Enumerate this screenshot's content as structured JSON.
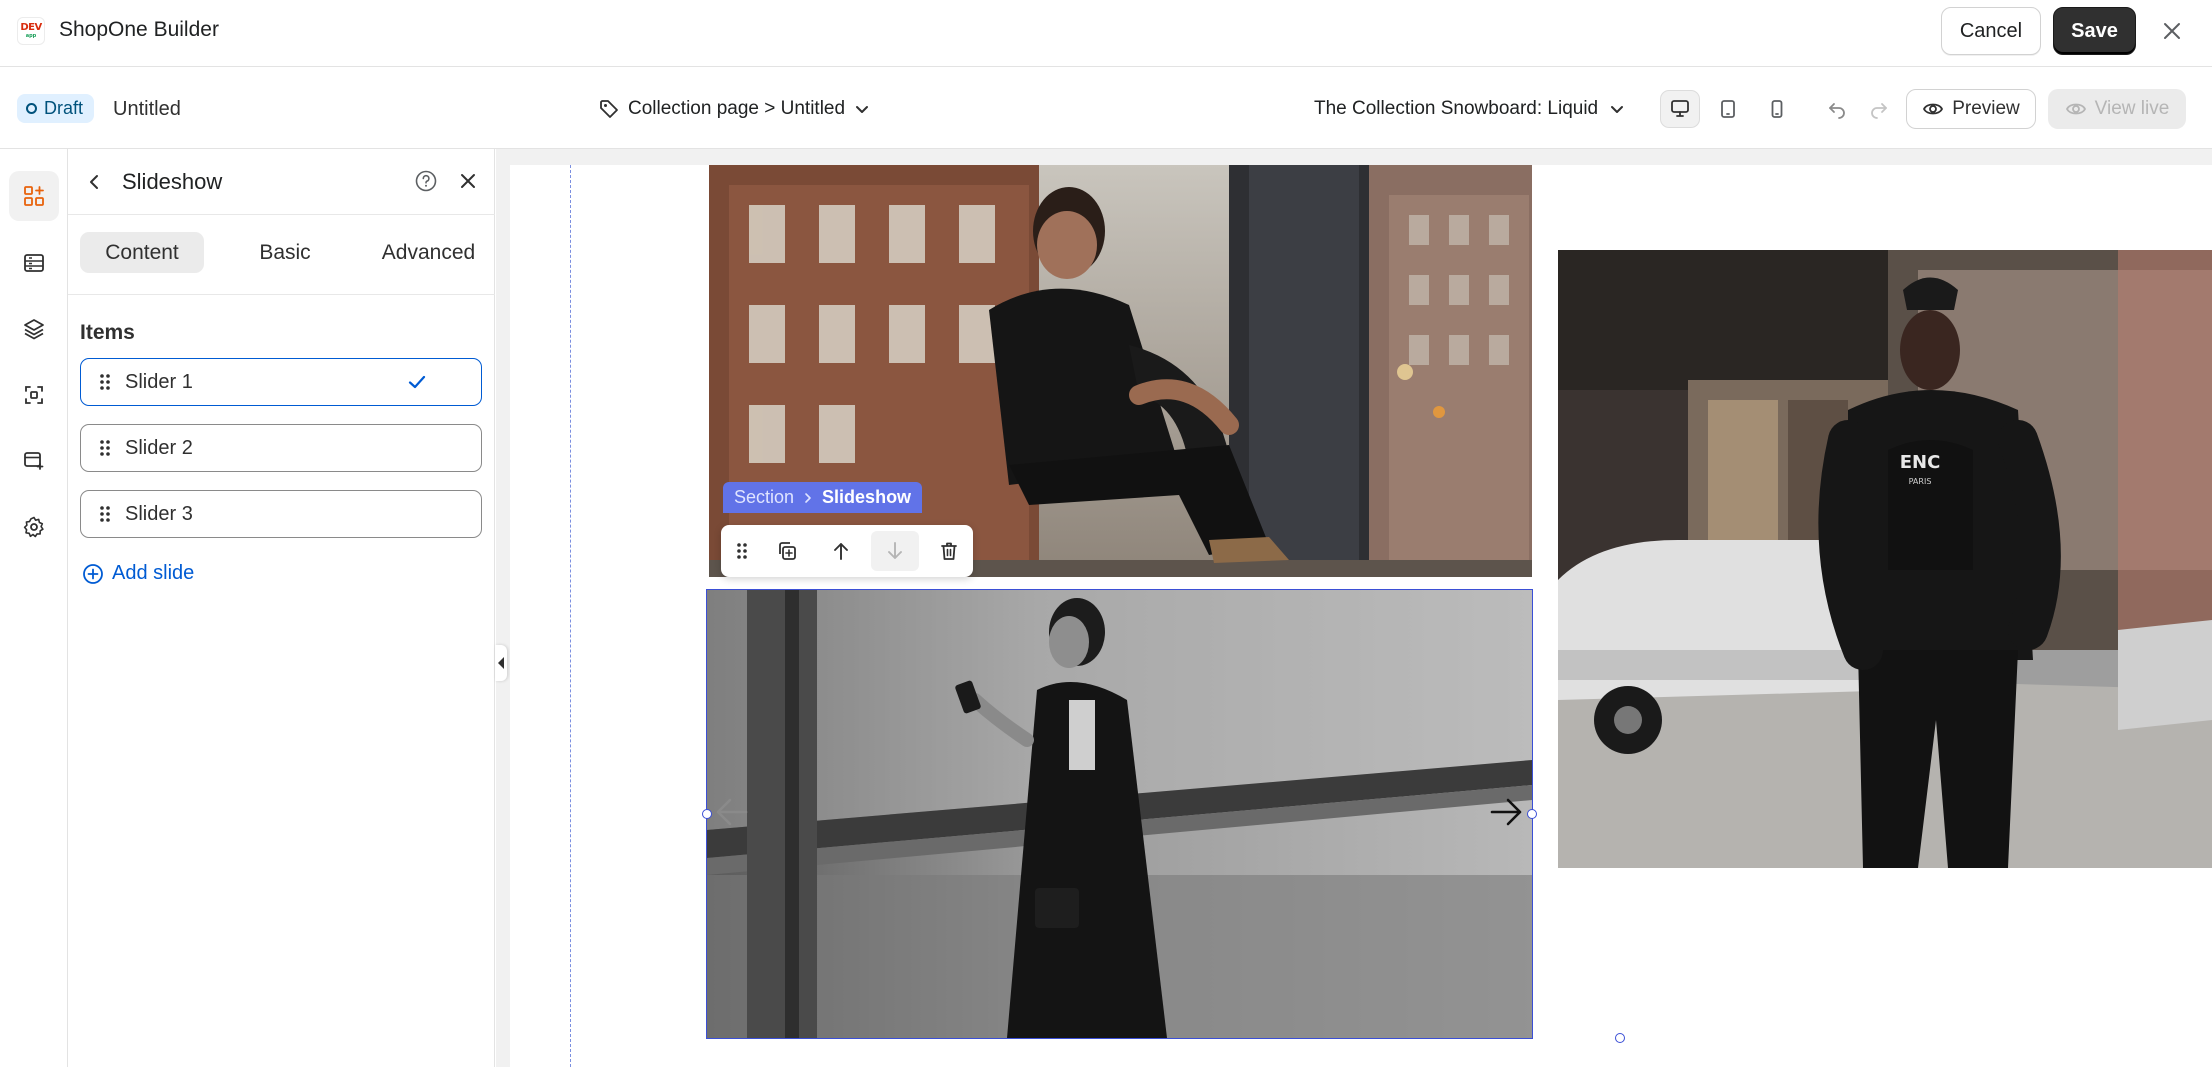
{
  "app": {
    "name": "ShopOne Builder",
    "logo_text": "DEV",
    "logo_subtext": "app"
  },
  "header": {
    "cancel_label": "Cancel",
    "save_label": "Save"
  },
  "subbar": {
    "status_badge": "Draft",
    "page_name": "Untitled",
    "page_selector": "Collection page > Untitled",
    "theme_selector": "The Collection Snowboard: Liquid",
    "preview_label": "Preview",
    "view_live_label": "View live"
  },
  "rail": {
    "items": [
      {
        "icon": "add-section-icon",
        "active": true
      },
      {
        "icon": "sections-icon",
        "active": false
      },
      {
        "icon": "layers-icon",
        "active": false
      },
      {
        "icon": "components-icon",
        "active": false
      },
      {
        "icon": "templates-icon",
        "active": false
      },
      {
        "icon": "settings-gear-icon",
        "active": false
      }
    ]
  },
  "panel": {
    "title": "Slideshow",
    "tabs": [
      {
        "label": "Content",
        "active": true
      },
      {
        "label": "Basic",
        "active": false
      },
      {
        "label": "Advanced",
        "active": false
      }
    ],
    "items_heading": "Items",
    "slides": [
      {
        "label": "Slider 1",
        "selected": true
      },
      {
        "label": "Slider 2",
        "selected": false
      },
      {
        "label": "Slider 3",
        "selected": false
      }
    ],
    "add_slide_label": "Add slide"
  },
  "canvas": {
    "breadcrumb": {
      "parent": "Section",
      "current": "Slideshow"
    },
    "shirt_text": "ENC",
    "shirt_subtext": "PARIS"
  },
  "colors": {
    "accent_blue": "#005bd3",
    "selection_blue": "#3b4fd6",
    "breadcrumb_bg": "#6173e8",
    "save_bg": "#303030",
    "draft_badge_bg": "#e0f0ff",
    "logo_red": "#d82c0d"
  }
}
